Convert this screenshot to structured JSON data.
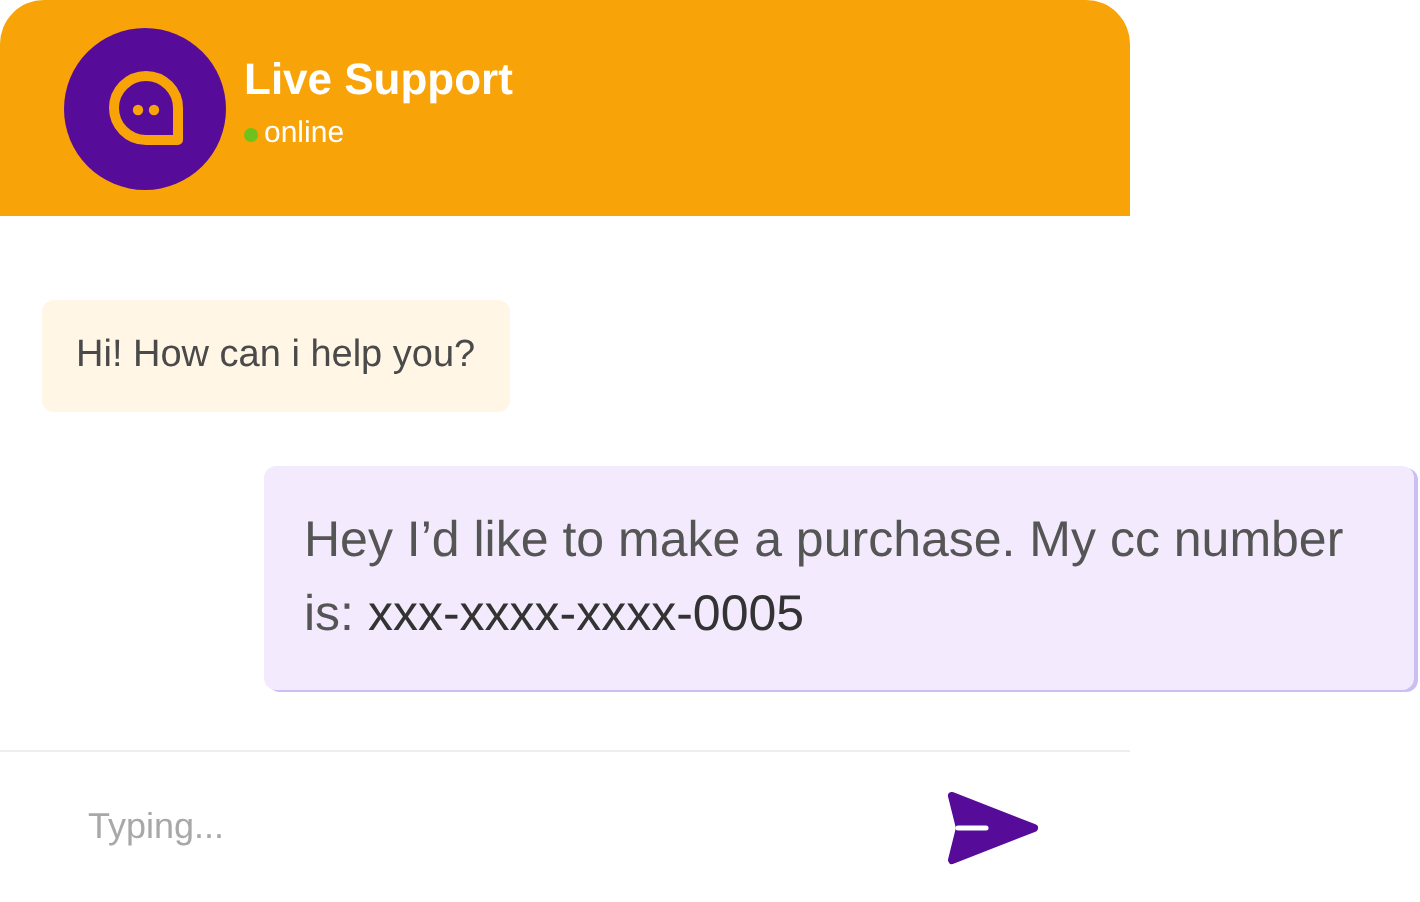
{
  "header": {
    "title": "Live Support",
    "status": "online",
    "online": true
  },
  "messages": [
    {
      "kind": "agent",
      "text": "Hi! How can i help you?"
    },
    {
      "kind": "user",
      "text": "Hey I’d like to make a purchase. My cc number is: **xxx-xxxx-xxxx-0005**"
    }
  ],
  "composer": {
    "placeholder": "Typing..."
  }
}
